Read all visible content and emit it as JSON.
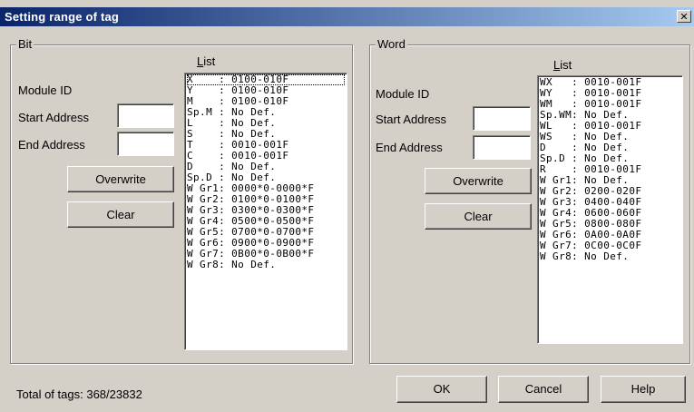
{
  "window": {
    "title": "Setting range of tag",
    "close_glyph": "✕"
  },
  "bit": {
    "caption": "Bit",
    "list_label": "List",
    "module_id_label": "Module ID",
    "start_address_label": "Start Address",
    "end_address_label": "End Address",
    "start_address_value": "",
    "end_address_value": "",
    "overwrite_label": "Overwrite",
    "clear_label": "Clear",
    "items": [
      "X    : 0100-010F",
      "Y    : 0100-010F",
      "M    : 0100-010F",
      "Sp.M : No Def.",
      "L    : No Def.",
      "S    : No Def.",
      "T    : 0010-001F",
      "C    : 0010-001F",
      "D    : No Def.",
      "Sp.D : No Def.",
      "W Gr1: 0000*0-0000*F",
      "W Gr2: 0100*0-0100*F",
      "W Gr3: 0300*0-0300*F",
      "W Gr4: 0500*0-0500*F",
      "W Gr5: 0700*0-0700*F",
      "W Gr6: 0900*0-0900*F",
      "W Gr7: 0B00*0-0B00*F",
      "W Gr8: No Def."
    ]
  },
  "word": {
    "caption": "Word",
    "list_label": "List",
    "module_id_label": "Module ID",
    "start_address_label": "Start Address",
    "end_address_label": "End Address",
    "start_address_value": "",
    "end_address_value": "",
    "overwrite_label": "Overwrite",
    "clear_label": "Clear",
    "items": [
      "WX   : 0010-001F",
      "WY   : 0010-001F",
      "WM   : 0010-001F",
      "Sp.WM: No Def.",
      "WL   : 0010-001F",
      "WS   : No Def.",
      "D    : No Def.",
      "Sp.D : No Def.",
      "R    : 0010-001F",
      "W Gr1: No Def.",
      "W Gr2: 0200-020F",
      "W Gr3: 0400-040F",
      "W Gr4: 0600-060F",
      "W Gr5: 0800-080F",
      "W Gr6: 0A00-0A0F",
      "W Gr7: 0C00-0C0F",
      "W Gr8: No Def."
    ]
  },
  "footer": {
    "total_tags_label": "Total of tags:",
    "total_tags_value": "368/23832",
    "ok_label": "OK",
    "cancel_label": "Cancel",
    "help_label": "Help"
  }
}
